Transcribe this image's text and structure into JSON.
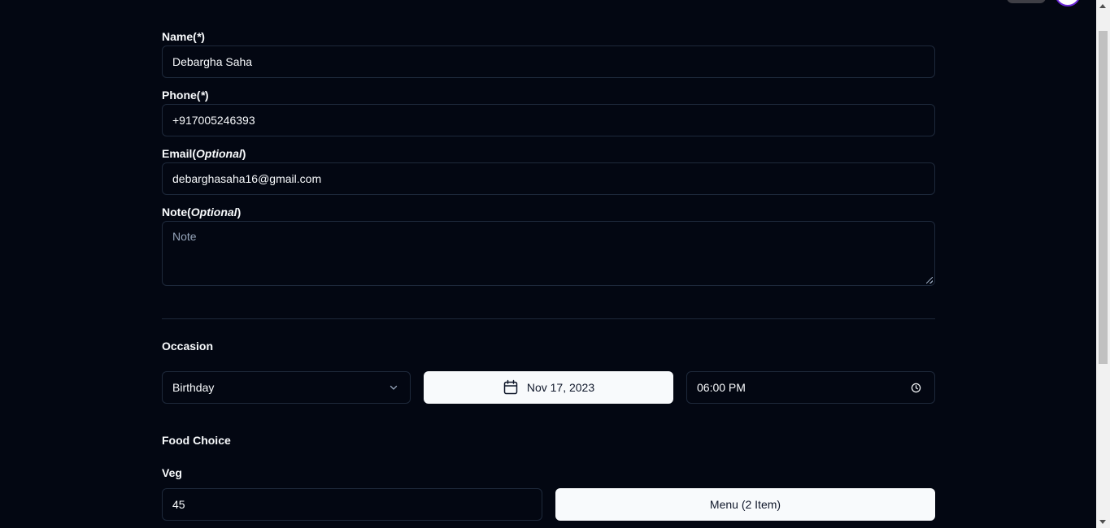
{
  "form": {
    "name": {
      "label": "Name(",
      "marker": "*",
      "label_end": ")",
      "value": "Debargha Saha"
    },
    "phone": {
      "label": "Phone(",
      "marker": "*",
      "label_end": ")",
      "value": "+917005246393"
    },
    "email": {
      "label": "Email(",
      "marker": "Optional",
      "label_end": ")",
      "value": "debarghasaha16@gmail.com"
    },
    "note": {
      "label": "Note(",
      "marker": "Optional",
      "label_end": ")",
      "placeholder": "Note",
      "value": ""
    }
  },
  "occasion": {
    "title": "Occasion",
    "selected": "Birthday",
    "date": "Nov 17, 2023",
    "time": "06:00 PM"
  },
  "food": {
    "title": "Food Choice",
    "veg_label": "Veg",
    "veg_value": "45",
    "menu_button": "Menu (2 Item)"
  },
  "icons": {
    "select": "chevron-down-icon",
    "date": "calendar-icon",
    "time": "clock-icon"
  },
  "colors": {
    "background": "#030712",
    "border": "#1e293b",
    "text": "#f8fafc",
    "button_bg": "#f8fafc",
    "button_text": "#0f172a",
    "placeholder": "#94a3b8"
  }
}
